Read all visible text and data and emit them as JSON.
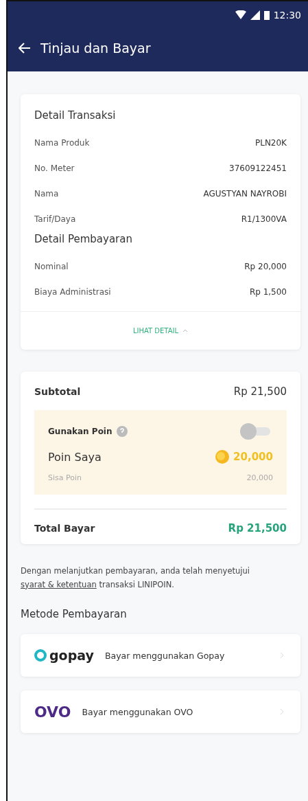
{
  "status_bar": {
    "time": "12:30"
  },
  "app_bar": {
    "title": "Tinjau dan Bayar"
  },
  "transaction_card": {
    "sections": [
      {
        "title": "Detail Transaksi",
        "rows": [
          {
            "label": "Nama Produk",
            "value": "PLN20K"
          },
          {
            "label": "No. Meter",
            "value": "37609122451"
          },
          {
            "label": "Nama",
            "value": "AGUSTYAN NAYROBI"
          },
          {
            "label": "Tarif/Daya",
            "value": "R1/1300VA"
          }
        ]
      },
      {
        "title": "Detail Pembayaran",
        "rows": [
          {
            "label": "Nominal",
            "value": "Rp 20,000"
          },
          {
            "label": "Biaya Administrasi",
            "value": "Rp 1,500"
          }
        ]
      }
    ],
    "toggle_label": "LIHAT DETAIL",
    "expanded": true
  },
  "summary_card": {
    "subtotal_label": "Subtotal",
    "subtotal_value": "Rp 21,500",
    "points": {
      "use_label": "Gunakan Poin",
      "on": false,
      "my_points_label": "Poin Saya",
      "my_points_value": "20,000",
      "remaining_label": "Sisa Poin",
      "remaining_value": "20,000"
    },
    "total_label": "Total Bayar",
    "total_value": "Rp 21,500"
  },
  "terms": {
    "before": "Dengan melanjutkan pembayaran, anda telah menyetujui",
    "link": "syarat & ketentuan",
    "after": "transaksi LINIPOIN."
  },
  "payment_methods": {
    "title": "Metode Pembayaran",
    "items": [
      {
        "kind": "gopay",
        "logo": "gopay",
        "label": "Bayar menggunakan Gopay"
      },
      {
        "kind": "ovo",
        "logo": "OVO",
        "label": "Bayar menggunakan OVO"
      }
    ]
  }
}
